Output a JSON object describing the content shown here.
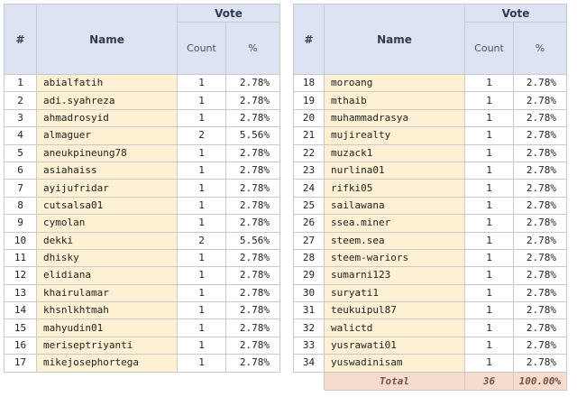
{
  "headers": {
    "num": "#",
    "name": "Name",
    "vote": "Vote",
    "count": "Count",
    "percent": "%"
  },
  "left_rows": [
    {
      "n": "1",
      "name": "abialfatih",
      "count": "1",
      "pct": "2.78%"
    },
    {
      "n": "2",
      "name": "adi.syahreza",
      "count": "1",
      "pct": "2.78%"
    },
    {
      "n": "3",
      "name": "ahmadrosyid",
      "count": "1",
      "pct": "2.78%"
    },
    {
      "n": "4",
      "name": "almaguer",
      "count": "2",
      "pct": "5.56%"
    },
    {
      "n": "5",
      "name": "aneukpineung78",
      "count": "1",
      "pct": "2.78%"
    },
    {
      "n": "6",
      "name": "asiahaiss",
      "count": "1",
      "pct": "2.78%"
    },
    {
      "n": "7",
      "name": "ayijufridar",
      "count": "1",
      "pct": "2.78%"
    },
    {
      "n": "8",
      "name": "cutsalsa01",
      "count": "1",
      "pct": "2.78%"
    },
    {
      "n": "9",
      "name": "cymolan",
      "count": "1",
      "pct": "2.78%"
    },
    {
      "n": "10",
      "name": "dekki",
      "count": "2",
      "pct": "5.56%"
    },
    {
      "n": "11",
      "name": "dhisky",
      "count": "1",
      "pct": "2.78%"
    },
    {
      "n": "12",
      "name": "elidiana",
      "count": "1",
      "pct": "2.78%"
    },
    {
      "n": "13",
      "name": "khairulamar",
      "count": "1",
      "pct": "2.78%"
    },
    {
      "n": "14",
      "name": "khsnlkhtmah",
      "count": "1",
      "pct": "2.78%"
    },
    {
      "n": "15",
      "name": "mahyudin01",
      "count": "1",
      "pct": "2.78%"
    },
    {
      "n": "16",
      "name": "meriseptriyanti",
      "count": "1",
      "pct": "2.78%"
    },
    {
      "n": "17",
      "name": "mikejosephortega",
      "count": "1",
      "pct": "2.78%"
    }
  ],
  "right_rows": [
    {
      "n": "18",
      "name": "moroang",
      "count": "1",
      "pct": "2.78%"
    },
    {
      "n": "19",
      "name": "mthaib",
      "count": "1",
      "pct": "2.78%"
    },
    {
      "n": "20",
      "name": "muhammadrasya",
      "count": "1",
      "pct": "2.78%"
    },
    {
      "n": "21",
      "name": "mujirealty",
      "count": "1",
      "pct": "2.78%"
    },
    {
      "n": "22",
      "name": "muzack1",
      "count": "1",
      "pct": "2.78%"
    },
    {
      "n": "23",
      "name": "nurlina01",
      "count": "1",
      "pct": "2.78%"
    },
    {
      "n": "24",
      "name": "rifki05",
      "count": "1",
      "pct": "2.78%"
    },
    {
      "n": "25",
      "name": "sailawana",
      "count": "1",
      "pct": "2.78%"
    },
    {
      "n": "26",
      "name": "ssea.miner",
      "count": "1",
      "pct": "2.78%"
    },
    {
      "n": "27",
      "name": "steem.sea",
      "count": "1",
      "pct": "2.78%"
    },
    {
      "n": "28",
      "name": "steem-wariors",
      "count": "1",
      "pct": "2.78%"
    },
    {
      "n": "29",
      "name": "sumarni123",
      "count": "1",
      "pct": "2.78%"
    },
    {
      "n": "30",
      "name": "suryati1",
      "count": "1",
      "pct": "2.78%"
    },
    {
      "n": "31",
      "name": "teukuipul87",
      "count": "1",
      "pct": "2.78%"
    },
    {
      "n": "32",
      "name": "walictd",
      "count": "1",
      "pct": "2.78%"
    },
    {
      "n": "33",
      "name": "yusrawati01",
      "count": "1",
      "pct": "2.78%"
    },
    {
      "n": "34",
      "name": "yuswadinisam",
      "count": "1",
      "pct": "2.78%"
    }
  ],
  "total": {
    "label": "Total",
    "count": "36",
    "pct": "100.00%"
  }
}
